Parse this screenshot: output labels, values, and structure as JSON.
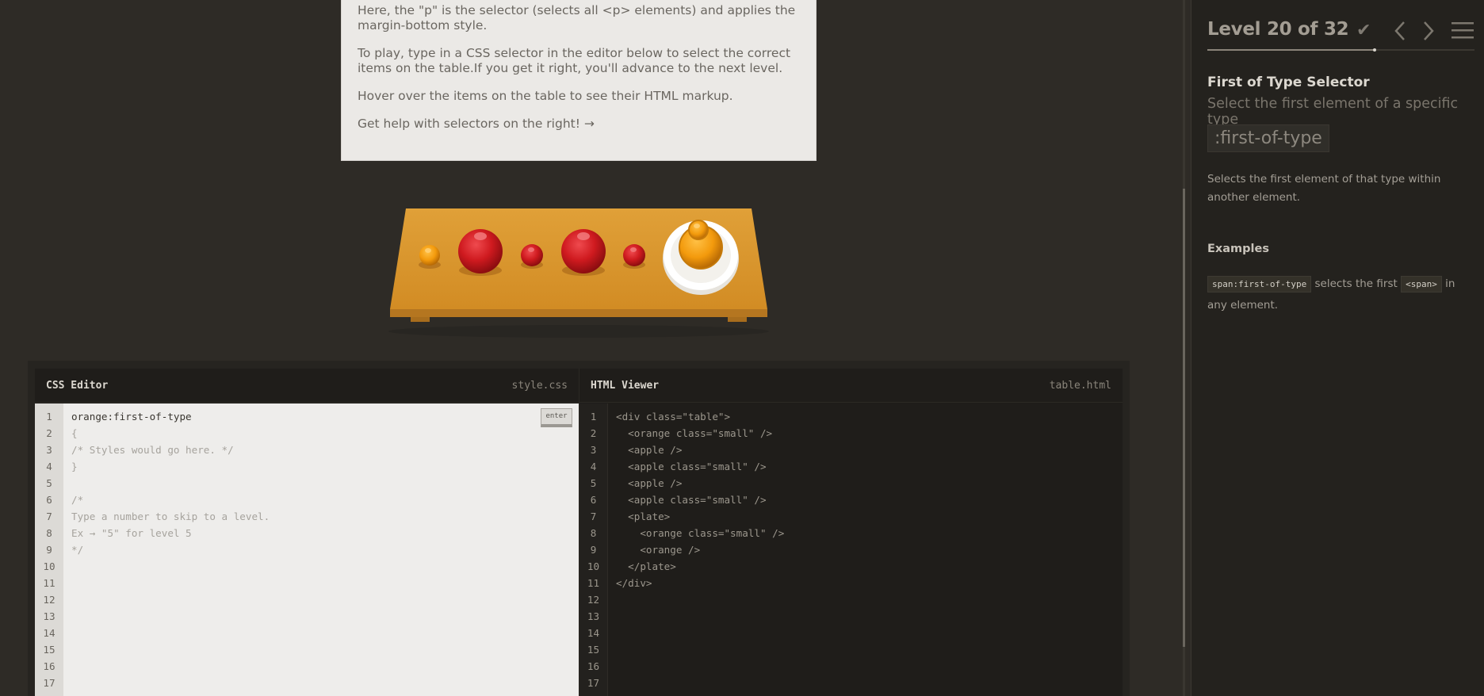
{
  "instructions": {
    "p1": "Here, the \"p\" is the selector (selects all <p> elements) and applies the margin-bottom style.",
    "p2": "To play, type in a CSS selector in the editor below to select the correct items on the table.If you get it right, you'll advance to the next level.",
    "p3": "Hover over the items on the table to see their HTML markup.",
    "p4": "Get help with selectors on the right! →"
  },
  "table_items": [
    {
      "type": "orange",
      "size": "small"
    },
    {
      "type": "apple",
      "size": "large"
    },
    {
      "type": "apple",
      "size": "small"
    },
    {
      "type": "apple",
      "size": "large"
    },
    {
      "type": "apple",
      "size": "small"
    },
    {
      "type": "plate",
      "contains": [
        "orange small",
        "orange large"
      ]
    }
  ],
  "css_editor": {
    "title": "CSS Editor",
    "filename": "style.css",
    "enter_label": "enter",
    "lines": [
      "orange:first-of-type",
      "{",
      "/* Styles would go here. */",
      "}",
      "",
      "/*",
      "Type a number to skip to a level.",
      "Ex → \"5\" for level 5",
      "*/",
      "",
      "",
      "",
      "",
      "",
      "",
      "",
      ""
    ]
  },
  "html_viewer": {
    "title": "HTML Viewer",
    "filename": "table.html",
    "lines": [
      "<div class=\"table\">",
      "  <orange class=\"small\" />",
      "  <apple />",
      "  <apple class=\"small\" />",
      "  <apple />",
      "  <apple class=\"small\" />",
      "  <plate>",
      "    <orange class=\"small\" />",
      "    <orange />",
      "  </plate>",
      "</div>",
      "",
      "",
      "",
      "",
      "",
      ""
    ]
  },
  "line_numbers": [
    "1",
    "2",
    "3",
    "4",
    "5",
    "6",
    "7",
    "8",
    "9",
    "10",
    "11",
    "12",
    "13",
    "14",
    "15",
    "16",
    "17"
  ],
  "sidebar": {
    "level_text": "Level 20 of 32",
    "level_current": 20,
    "level_total": 32,
    "selector_name": "First of Type Selector",
    "selector_title": "Select the first element of a specific type",
    "syntax": ":first-of-type",
    "hint": "Selects the first element of that type within another element.",
    "examples_heading": "Examples",
    "example": {
      "code": "span:first-of-type",
      "text_before": " selects the first ",
      "tag": "<span>",
      "text_after": " in any element."
    }
  },
  "icons": [
    "check-icon",
    "chevron-left-icon",
    "chevron-right-icon",
    "menu-icon"
  ],
  "colors": {
    "background": "#2e2b26",
    "sidebar": "#24221e",
    "table_wood": "#d9952e",
    "apple": "#c8161b",
    "orange": "#f49b0b",
    "plate": "#ffffff"
  }
}
